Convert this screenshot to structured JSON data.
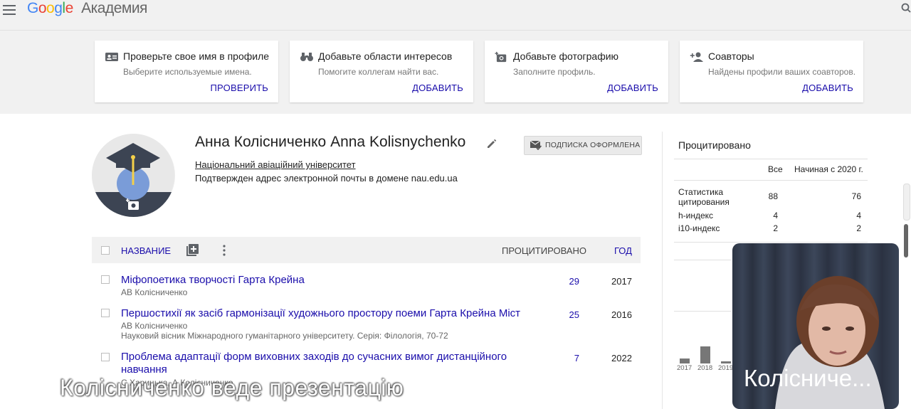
{
  "header": {
    "logo_brand": "Google",
    "logo_sub": "Академия"
  },
  "suggestions": [
    {
      "title": "Проверьте свое имя в профиле",
      "subtitle": "Выберите используемые имена.",
      "action": "ПРОВЕРИТЬ"
    },
    {
      "title": "Добавьте области интересов",
      "subtitle": "Помогите коллегам найти вас.",
      "action": "ДОБАВИТЬ"
    },
    {
      "title": "Добавьте фотографию",
      "subtitle": "Заполните профиль.",
      "action": "ДОБАВИТЬ"
    },
    {
      "title": "Соавторы",
      "subtitle": "Найдены профили ваших соавторов.",
      "action": "ДОБАВИТЬ"
    }
  ],
  "profile": {
    "name": "Анна Колісниченко Anna Kolisnychenko",
    "affiliation": "Національний авіаційний університет",
    "email_note": "Подтвержден адрес электронной почты в домене nau.edu.ua",
    "follow_label": "ПОДПИСКА ОФОРМЛЕНА"
  },
  "table": {
    "col_title": "НАЗВАНИЕ",
    "col_cited": "ПРОЦИТИРОВАНО",
    "col_year": "ГОД",
    "rows": [
      {
        "title": "Міфопоетика творчості Гарта Крейна",
        "authors": "АВ Колісниченко",
        "venue": "",
        "cited": "29",
        "year": "2017"
      },
      {
        "title": "Першостихії як засіб гармонізації художнього простору поеми Гарта Крейна Міст",
        "authors": "АВ Колісниченко",
        "venue": "Науковий вісник Міжнародного гуманітарного університету. Серія: Філологія, 70-72",
        "cited": "25",
        "year": "2016"
      },
      {
        "title": "Проблема адаптації форм виховних заходів до сучасних вимог дистанційного навчання",
        "authors": "С Харицька, А Колісниченко",
        "venue": "",
        "cited": "7",
        "year": "2022"
      }
    ]
  },
  "citations": {
    "title": "Процитировано",
    "col_all": "Все",
    "col_since": "Начиная с 2020 г.",
    "rows": [
      {
        "label": "Статистика цитирования",
        "all": "88",
        "since": "76"
      },
      {
        "label": "h-индекс",
        "all": "4",
        "since": "4"
      },
      {
        "label": "i10-индекс",
        "all": "2",
        "since": "2"
      }
    ],
    "chart_years": [
      "2017",
      "2018",
      "2019"
    ]
  },
  "video": {
    "participant_name": "Колісниче..."
  },
  "caption": {
    "text": "Колісниченко веде презентацію"
  }
}
